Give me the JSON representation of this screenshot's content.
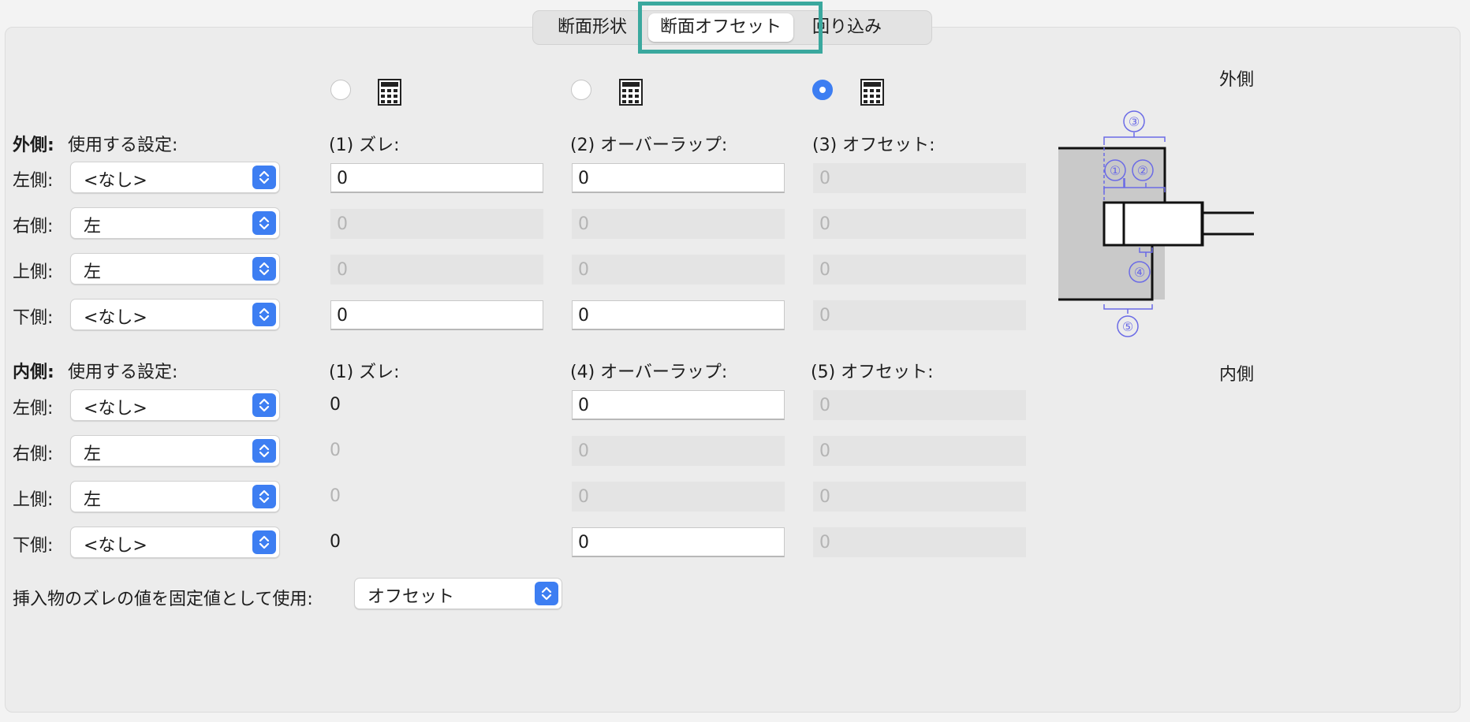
{
  "tabs": [
    {
      "label": "断面形状"
    },
    {
      "label": "断面オフセット"
    },
    {
      "label": "回り込み"
    }
  ],
  "outer": {
    "heading": "外側:",
    "setting_header": "使用する設定:",
    "col1_header": "(1) ズレ:",
    "col2_header": "(2) オーバーラップ:",
    "col3_header": "(3) オフセット:",
    "rows": [
      {
        "label": "左側:",
        "select": "<なし>",
        "v1": "0",
        "v2": "0",
        "v3": "0"
      },
      {
        "label": "右側:",
        "select": "左",
        "v1": "0",
        "v2": "0",
        "v3": "0"
      },
      {
        "label": "上側:",
        "select": "左",
        "v1": "0",
        "v2": "0",
        "v3": "0"
      },
      {
        "label": "下側:",
        "select": "<なし>",
        "v1": "0",
        "v2": "0",
        "v3": "0"
      }
    ]
  },
  "inner": {
    "heading": "内側:",
    "setting_header": "使用する設定:",
    "col1_header": "(1) ズレ:",
    "col2_header": "(4) オーバーラップ:",
    "col3_header": "(5) オフセット:",
    "rows": [
      {
        "label": "左側:",
        "select": "<なし>",
        "v1": "0",
        "v2": "0",
        "v3": "0"
      },
      {
        "label": "右側:",
        "select": "左",
        "v1": "0",
        "v2": "0",
        "v3": "0"
      },
      {
        "label": "上側:",
        "select": "左",
        "v1": "0",
        "v2": "0",
        "v3": "0"
      },
      {
        "label": "下側:",
        "select": "<なし>",
        "v1": "0",
        "v2": "0",
        "v3": "0"
      }
    ]
  },
  "radio_selected": 3,
  "footer": {
    "label": "挿入物のズレの値を固定値として使用:",
    "select": "オフセット"
  },
  "diagram": {
    "outer_label": "外側",
    "inner_label": "内側",
    "markers": [
      "③",
      "①",
      "②",
      "④",
      "⑤"
    ]
  },
  "colors": {
    "accent": "#3d7ef2",
    "highlight": "#3aa89e",
    "diagram_marker": "#6b6be6"
  }
}
